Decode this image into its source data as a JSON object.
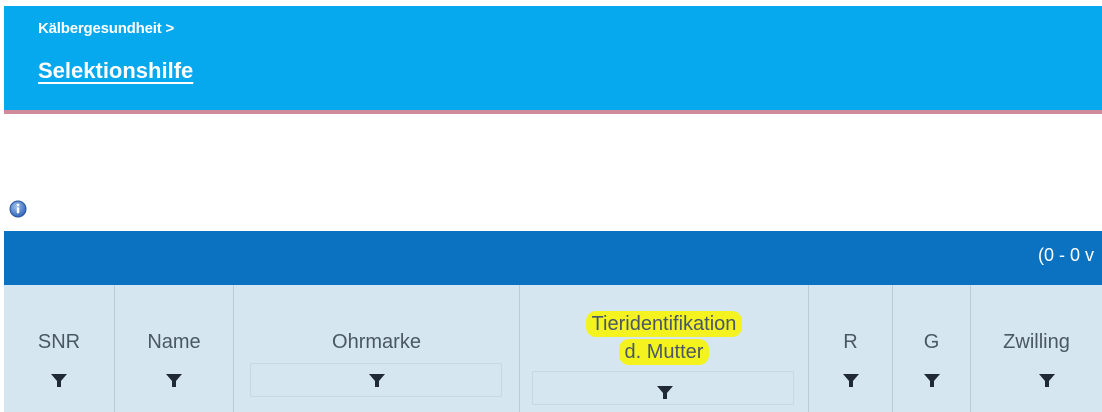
{
  "header": {
    "breadcrumb": "Kälbergesundheit >",
    "title": "Selektionshilfe"
  },
  "info": {
    "icon": "info-icon"
  },
  "table": {
    "pagination_text": "(0 - 0 v",
    "columns": [
      {
        "label": "SNR"
      },
      {
        "label": "Name"
      },
      {
        "label": "Ohrmarke"
      },
      {
        "label_line1": "Tieridentifikation",
        "label_line2": "d. Mutter",
        "highlight": "#f4f31f"
      },
      {
        "label": "R"
      },
      {
        "label": "G"
      },
      {
        "label": "Zwilling"
      }
    ]
  },
  "colors": {
    "header_bg": "#06a8ee",
    "header_accent_line": "#cf8b9a",
    "table_bar": "#0a72c0",
    "column_header_bg": "#d6e6f0",
    "highlight": "#f4f31f"
  }
}
